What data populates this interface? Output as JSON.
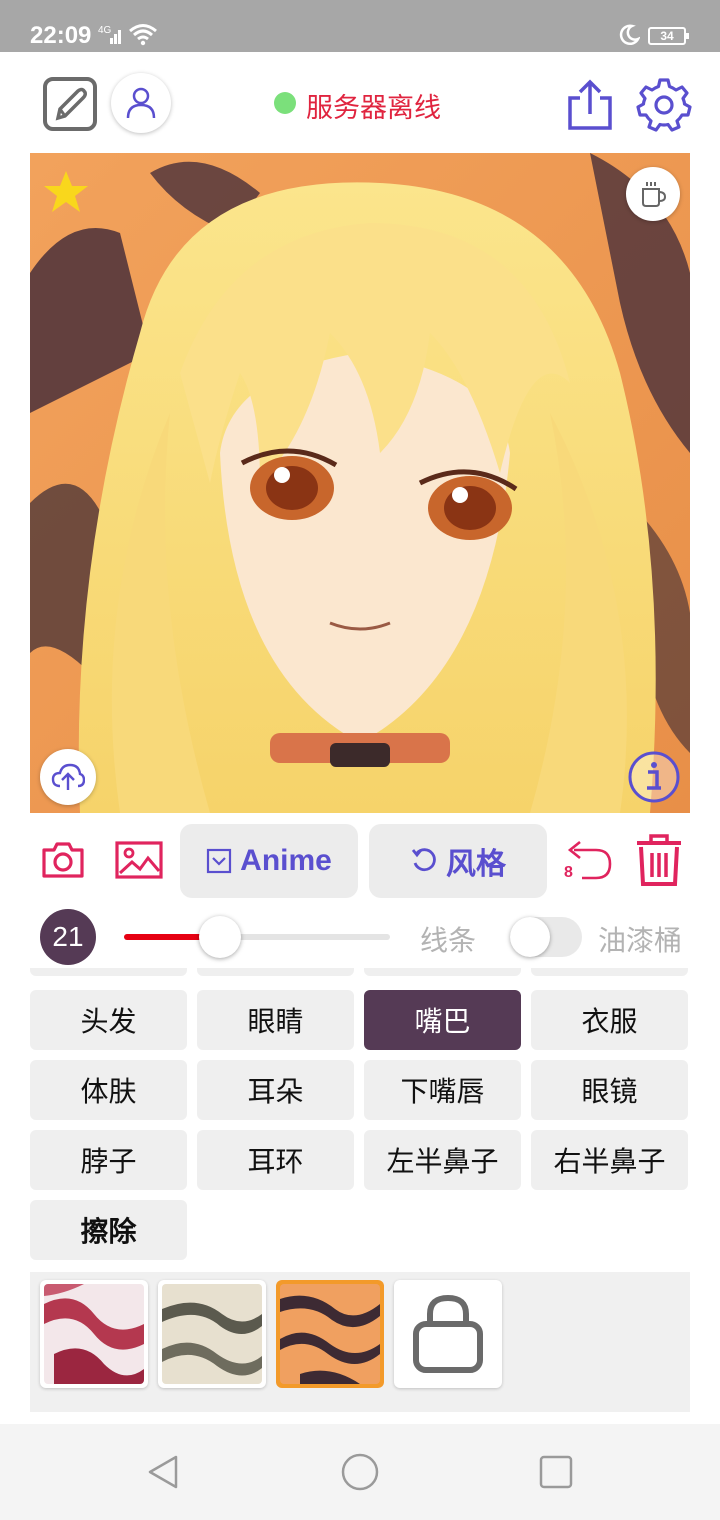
{
  "statusbar": {
    "time": "22:09",
    "network": "4G",
    "battery": "34"
  },
  "header": {
    "server_status": "服务器离线",
    "status_color": "#7be07b",
    "status_text_color": "#e0243f"
  },
  "colors": {
    "accent": "#5a4fcf",
    "pink": "#e0245e",
    "selected": "#553a55",
    "slider": "#e60012"
  },
  "tools": {
    "model_label": "Anime",
    "style_label": "风格",
    "undo_count": "8"
  },
  "brush": {
    "size": "21",
    "size_level": 0.36,
    "line_label": "线条",
    "bucket_label": "油漆桶",
    "bucket_on": false
  },
  "parts": [
    {
      "label": "头发"
    },
    {
      "label": "眼睛"
    },
    {
      "label": "嘴巴"
    },
    {
      "label": "衣服"
    },
    {
      "label": "体肤"
    },
    {
      "label": "耳朵"
    },
    {
      "label": "下嘴唇"
    },
    {
      "label": "眼镜"
    },
    {
      "label": "脖子"
    },
    {
      "label": "耳环"
    },
    {
      "label": "左半鼻子"
    },
    {
      "label": "右半鼻子"
    },
    {
      "label": "擦除"
    }
  ],
  "selected_part": "嘴巴",
  "swatches": [
    {
      "name": "pink-marble",
      "selected": false
    },
    {
      "name": "gray-marble",
      "selected": false
    },
    {
      "name": "orange-tiger",
      "selected": true
    },
    {
      "name": "shop-bag-icon",
      "selected": false
    }
  ]
}
